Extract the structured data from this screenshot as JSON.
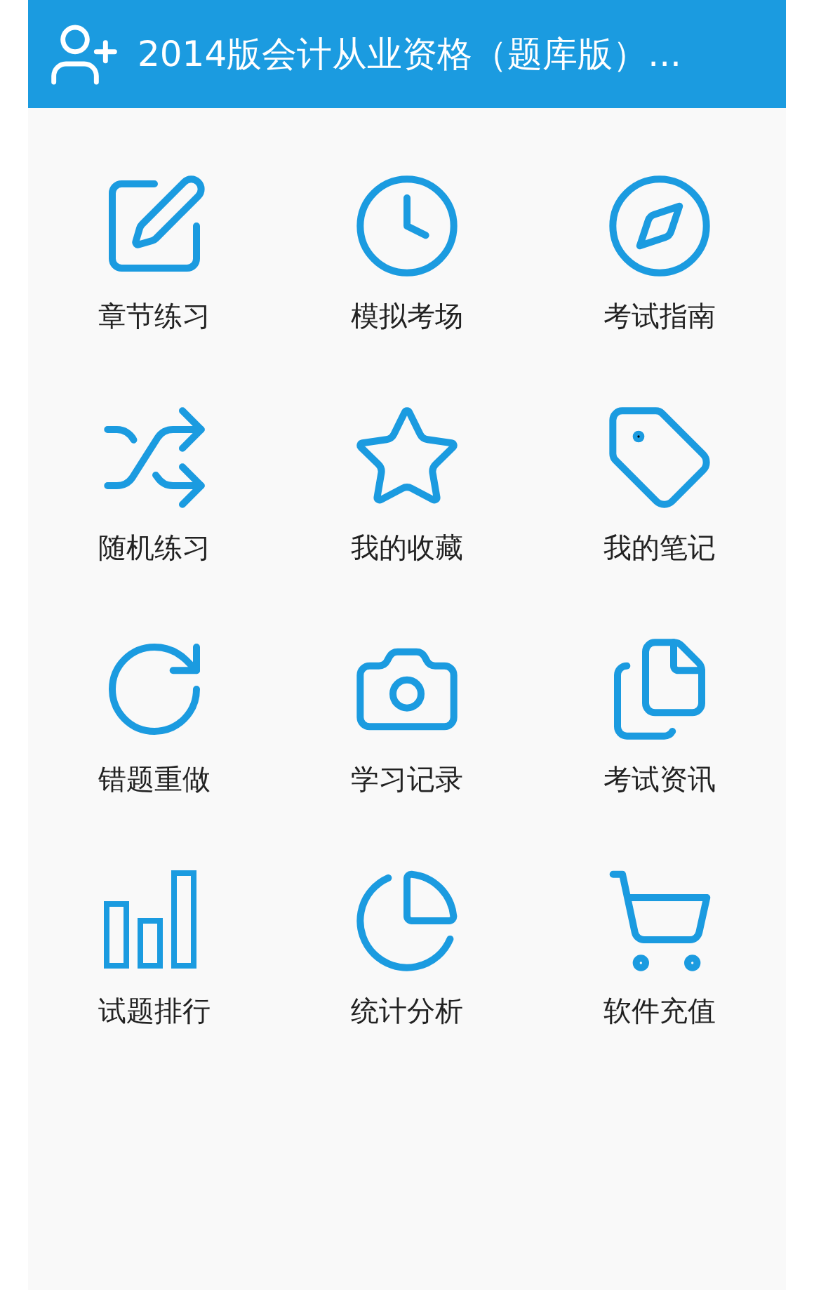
{
  "header": {
    "title": "2014版会计从业资格（题库版）..."
  },
  "menu": [
    {
      "label": "章节练习"
    },
    {
      "label": "模拟考场"
    },
    {
      "label": "考试指南"
    },
    {
      "label": "随机练习"
    },
    {
      "label": "我的收藏"
    },
    {
      "label": "我的笔记"
    },
    {
      "label": "错题重做"
    },
    {
      "label": "学习记录"
    },
    {
      "label": "考试资讯"
    },
    {
      "label": "试题排行"
    },
    {
      "label": "统计分析"
    },
    {
      "label": "软件充值"
    }
  ]
}
